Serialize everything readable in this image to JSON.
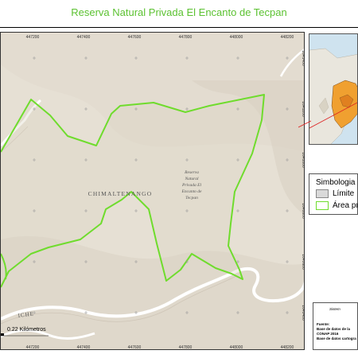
{
  "title": "Reserva Natural Privada El Encanto de Tecpan",
  "map": {
    "department_label": "CHIMALTENANGO",
    "road_label": "ICHE",
    "reserve_label": [
      "Reserva",
      "Natural",
      "Privada El",
      "Encanto de",
      "Tecpan"
    ],
    "x_ticks": [
      "447200",
      "447400",
      "447600",
      "447800",
      "448000",
      "448200"
    ],
    "y_ticks_right": [
      "1641400",
      "1641200",
      "1641000",
      "1640800",
      "1640600",
      "1640400"
    ],
    "scale_text": "0.22 Kilómetros",
    "boundary_color": "#6fdc2d"
  },
  "legend": {
    "title": "Simbologia",
    "items": [
      {
        "label": "Límite",
        "color": "#d9d9d9"
      },
      {
        "label": "Área pr",
        "color": "#6fdc2d"
      }
    ]
  },
  "info": {
    "heading": "Sistem",
    "source_label": "Fuente:",
    "line1": "Base de datos de la",
    "line2": "CONAP 2016",
    "line3": "Base de datos cartogra"
  }
}
